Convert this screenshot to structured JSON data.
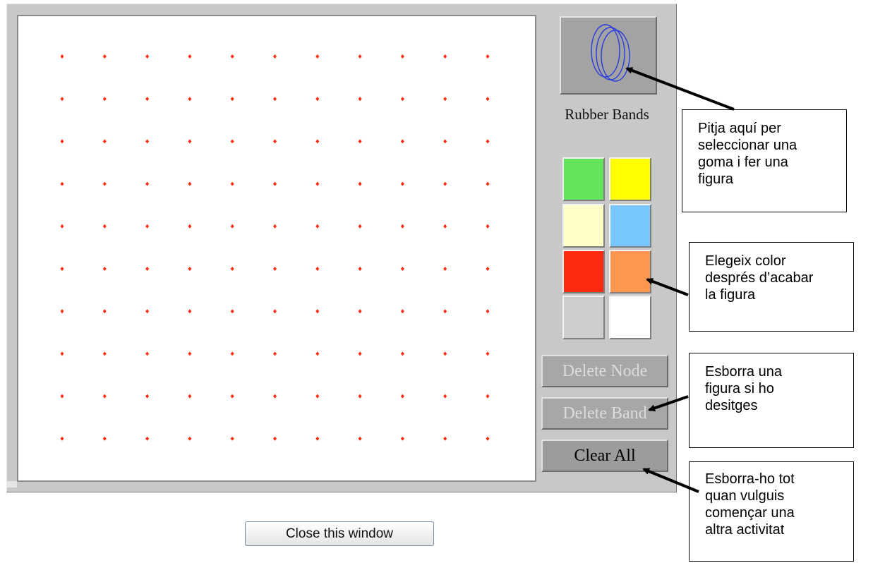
{
  "colors": {
    "peg": "#ff2a10",
    "band_icon": "#2a3adf",
    "panel": "#c8c8c8"
  },
  "board": {
    "columns": 11,
    "rows": 10
  },
  "tools": {
    "band_tool_icon": "rubber-bands-icon",
    "band_tool_label": "Rubber Bands",
    "swatches": [
      "#64e45c",
      "#ffff00",
      "#ffffc8",
      "#78c8ff",
      "#ff2a0f",
      "#ff9650",
      "#cdcdcd",
      "#ffffff"
    ],
    "delete_node": "Delete Node",
    "delete_band": "Delete Band",
    "clear_all": "Clear All"
  },
  "close_button": "Close this window",
  "callouts": {
    "band_tool": [
      "Pitja aquí per",
      "seleccionar una",
      "goma i fer una",
      "figura"
    ],
    "color": [
      "Elegeix color",
      "després d’acabar",
      "la figura"
    ],
    "delete_band": [
      "Esborra una",
      "figura si ho",
      "desitges"
    ],
    "clear_all": [
      "Esborra-ho tot",
      "quan vulguis",
      "començar una",
      "altra activitat"
    ]
  }
}
